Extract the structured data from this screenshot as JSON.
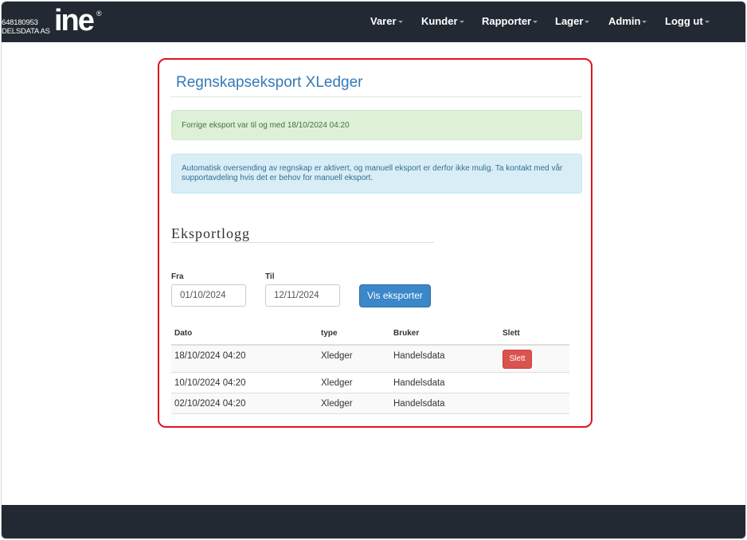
{
  "navbar": {
    "brand_line1": "648180953",
    "brand_line2": "DELSDATA AS",
    "logo": "ine",
    "logo_mark": "®",
    "items": [
      {
        "label": "Varer"
      },
      {
        "label": "Kunder"
      },
      {
        "label": "Rapporter"
      },
      {
        "label": "Lager"
      },
      {
        "label": "Admin"
      },
      {
        "label": "Logg ut"
      }
    ]
  },
  "page": {
    "title": "Regnskapseksport XLedger",
    "alert_success": "Forrige eksport var til og med 18/10/2024 04:20",
    "alert_info": "Automatisk oversending av regnskap er aktivert, og manuell eksport er derfor ikke mulig. Ta kontakt med vår supportavdeling hvis det er behov for manuell eksport."
  },
  "log": {
    "title": "Eksportlogg",
    "from_label": "Fra",
    "from_value": "01/10/2024",
    "to_label": "Til",
    "to_value": "12/11/2024",
    "show_button": "Vis eksporter",
    "columns": [
      "Dato",
      "type",
      "Bruker",
      "Slett"
    ],
    "rows": [
      {
        "date": "18/10/2024 04:20",
        "type": "Xledger",
        "user": "Handelsdata",
        "delete": "Slett"
      },
      {
        "date": "10/10/2024 04:20",
        "type": "Xledger",
        "user": "Handelsdata"
      },
      {
        "date": "02/10/2024 04:20",
        "type": "Xledger",
        "user": "Handelsdata"
      }
    ]
  },
  "colors": {
    "navbar_bg": "#222932",
    "highlight_border": "#e0141e",
    "title_blue": "#337ab7",
    "danger": "#d9534f",
    "primary": "#3a87c9"
  }
}
